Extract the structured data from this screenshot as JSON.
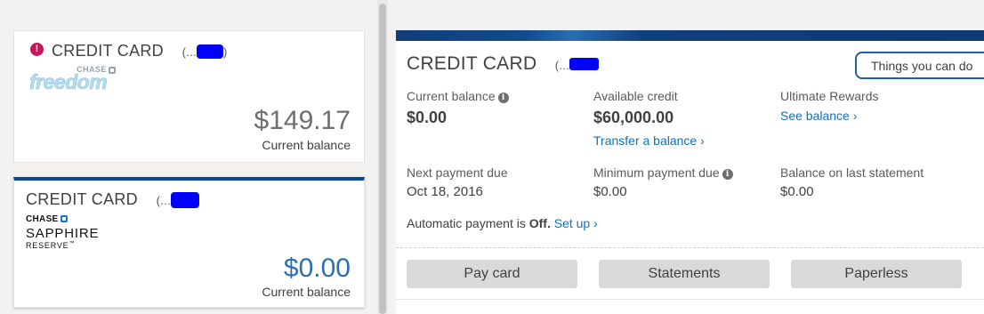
{
  "accounts": [
    {
      "title": "CREDIT CARD",
      "masked_prefix": "(...",
      "masked_suffix": ")",
      "has_alert": true,
      "brand_line1": "CHASE",
      "brand_line2": "freedom",
      "amount": "$149.17",
      "amount_label": "Current balance",
      "amount_color": "#6d6e70"
    },
    {
      "title": "CREDIT CARD",
      "masked_prefix": "(...",
      "has_alert": false,
      "brand_line1": "CHASE",
      "brand_line2": "SAPPHIRE",
      "brand_line3": "RESERVE",
      "brand_tm": "™",
      "amount": "$0.00",
      "amount_label": "Current balance",
      "amount_color": "#2a6fb0",
      "selected": true
    }
  ],
  "detail": {
    "title": "CREDIT CARD",
    "masked_prefix": "(...",
    "things_button": "Things you can do",
    "current_balance_label": "Current balance",
    "current_balance": "$0.00",
    "available_credit_label": "Available credit",
    "available_credit": "$60,000.00",
    "transfer_link": "Transfer a balance",
    "rewards_label": "Ultimate Rewards",
    "rewards_link": "See balance",
    "next_payment_label": "Next payment due",
    "next_payment": "Oct 18, 2016",
    "min_payment_label": "Minimum payment due",
    "min_payment": "$0.00",
    "last_statement_label": "Balance on last statement",
    "last_statement": "$0.00",
    "autopay_prefix": "Automatic payment is",
    "autopay_state": "Off.",
    "autopay_link": "Set up",
    "actions": [
      "Pay card",
      "Statements",
      "Paperless"
    ]
  },
  "colors": {
    "accent": "#1170c0",
    "banner": "#0f3d78",
    "mask": "#0000ff",
    "alert": "#c2185b"
  },
  "icons": [
    "alert-icon",
    "info-icon",
    "chevron-right-icon",
    "chase-octagon-icon"
  ]
}
